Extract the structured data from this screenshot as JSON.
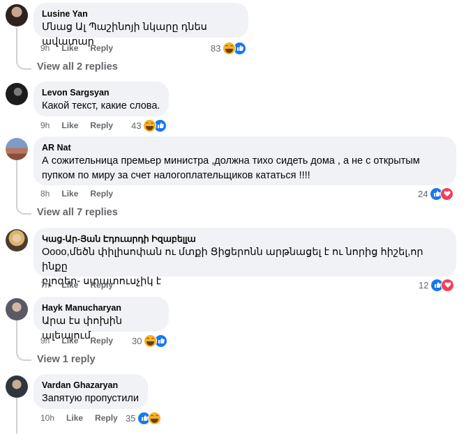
{
  "comments": [
    {
      "author": "Lusine Yan",
      "text": "Մնաց Ալ Պաշինոյի նկարը դնես ավատար",
      "time": "9h",
      "like": "Like",
      "reply": "Reply",
      "reactions": "83",
      "reaction_icons": [
        "haha-icon",
        "like-icon"
      ],
      "view_replies": "View all 2 replies"
    },
    {
      "author": "Levon Sargsyan",
      "text": "Какой текст, какие слова.",
      "time": "9h",
      "like": "Like",
      "reply": "Reply",
      "reactions": "43",
      "reaction_icons": [
        "haha-icon",
        "like-icon"
      ]
    },
    {
      "author": "AR Nat",
      "text_line1": "А сожительница премьер министра ,должна тихо сидеть дома , а не с открытым",
      "text_line2": "пупком по миру за счет налогоплательщиков кататься !!!!",
      "time": "8h",
      "like": "Like",
      "reply": "Reply",
      "reactions": "24",
      "reaction_icons": [
        "like-icon",
        "love-icon"
      ],
      "view_replies": "View all 7 replies"
    },
    {
      "author": "Կաց-Ար-Յան Էդուարդի Իզաբելլա",
      "text_line1": "Oooo,մեծն փիլիսոփան ու մտքի Ցիցերոնն արթնացել է ու նորից հիշել,որ ինքը",
      "text_line2": "բլոգեր- ստատուսչիկ է",
      "time": "7h",
      "like": "Like",
      "reply": "Reply",
      "reactions": "12",
      "reaction_icons": [
        "like-icon",
        "love-icon"
      ]
    },
    {
      "author": "Hayk Manucharyan",
      "text": "Արա էս փոխին ալեայում",
      "time": "9h",
      "like": "Like",
      "reply": "Reply",
      "reactions": "30",
      "reaction_icons": [
        "haha-icon",
        "like-icon"
      ],
      "view_replies": "View 1 reply"
    },
    {
      "author": "Vardan Ghazaryan",
      "text": "Запятую пропустили",
      "time": "10h",
      "like": "Like",
      "reply": "Reply",
      "reactions": "35",
      "reaction_icons": [
        "like-icon",
        "haha-icon"
      ]
    }
  ],
  "colors": {
    "like": "#1877f2",
    "love": "#f33e58",
    "haha": "#f7b125",
    "bubble": "#f0f2f5",
    "meta": "#65676b"
  }
}
